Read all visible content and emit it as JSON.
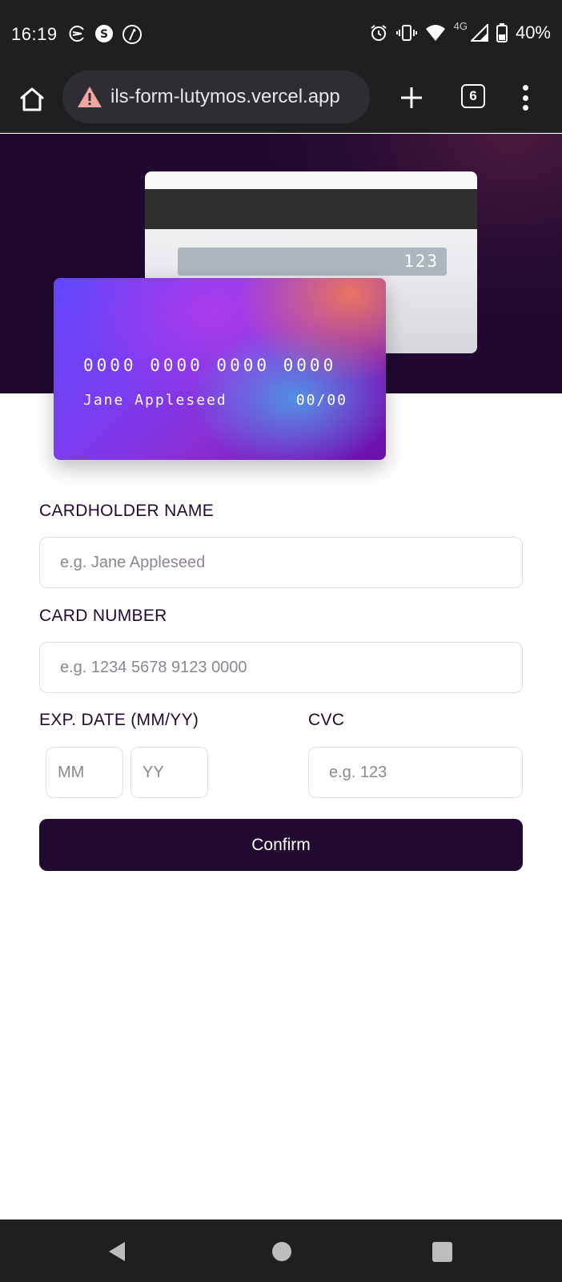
{
  "status_bar": {
    "time": "16:19",
    "network": "4G",
    "battery": "40%",
    "left_icons": [
      "app-notification-icon",
      "s-circle-icon",
      "info-slash-icon"
    ],
    "right_icons": [
      "alarm-icon",
      "vibrate-icon",
      "wifi-icon",
      "signal-icon",
      "battery-icon"
    ]
  },
  "browser": {
    "url": "ils-form-lutymos.vercel.app",
    "tab_count": "6",
    "security_state": "warning"
  },
  "card_preview": {
    "number": "0000 0000 0000 0000",
    "name": "Jane Appleseed",
    "expiry": "00/00",
    "cvc": "123"
  },
  "form": {
    "cardholder_label": "CARDHOLDER NAME",
    "cardholder_placeholder": "e.g. Jane Appleseed",
    "number_label": "CARD NUMBER",
    "number_placeholder": "e.g. 1234 5678 9123 0000",
    "expiry_label": "EXP. DATE (MM/YY)",
    "month_placeholder": "MM",
    "year_placeholder": "YY",
    "cvc_label": "CVC",
    "cvc_placeholder": "e.g. 123",
    "confirm_label": "Confirm"
  },
  "colors": {
    "accent_dark": "#21092f",
    "input_border": "#dedddf",
    "system_bar": "#1f1e21"
  }
}
